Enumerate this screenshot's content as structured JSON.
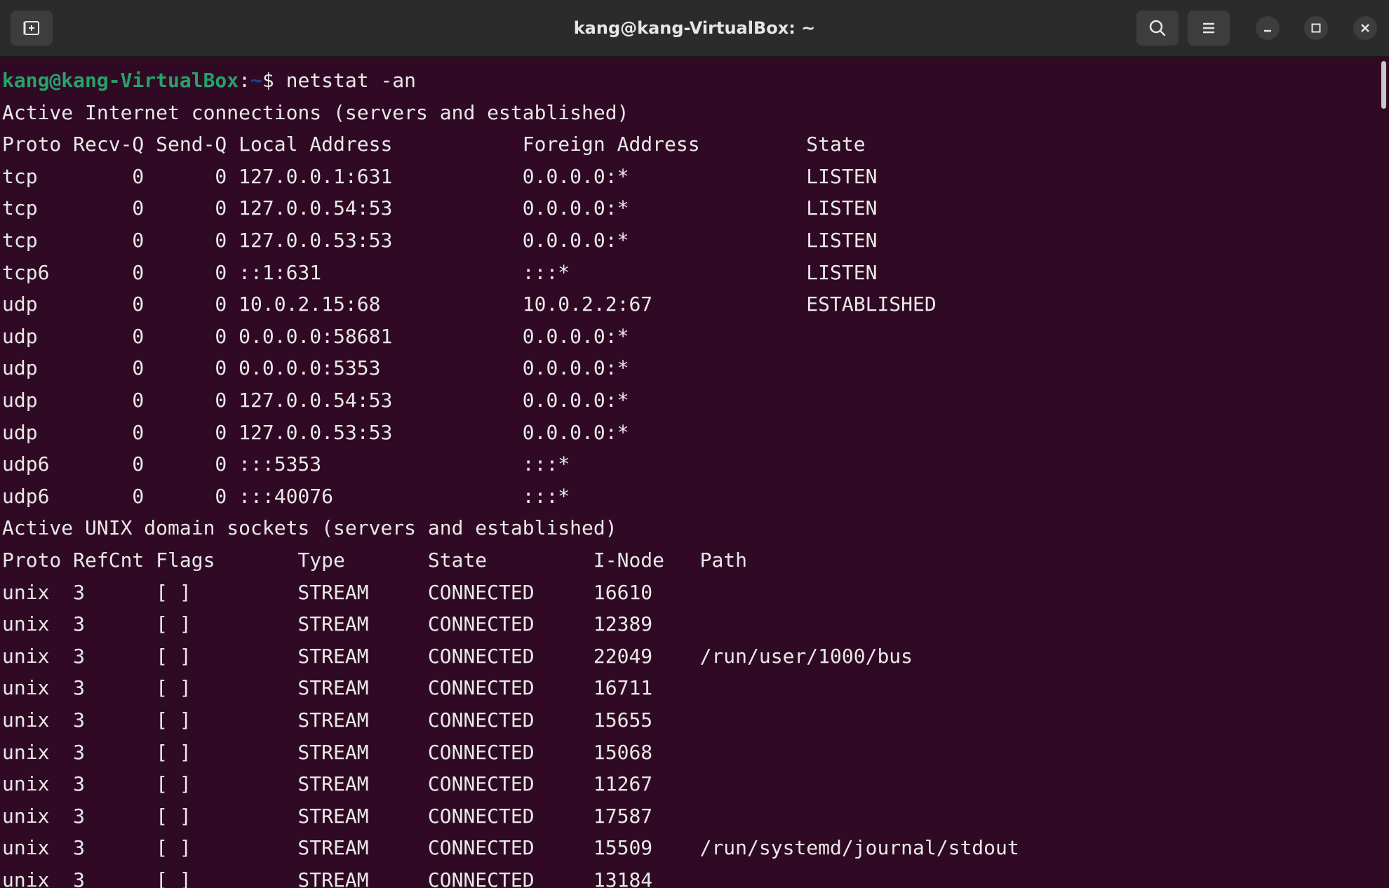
{
  "window": {
    "title": "kang@kang-VirtualBox: ~"
  },
  "icons": {
    "new_tab": "new-tab-icon",
    "search": "search-icon",
    "menu": "hamburger-menu-icon",
    "minimize": "minimize-icon",
    "maximize": "maximize-icon",
    "close": "close-icon"
  },
  "colors": {
    "background": "#300a24",
    "titlebar": "#2b2b2b",
    "prompt_user": "#26a269",
    "prompt_path": "#12488b",
    "text": "#e8e8e8"
  },
  "terminal": {
    "prompt": {
      "user_host": "kang@kang-VirtualBox",
      "colon": ":",
      "path": "~",
      "symbol": "$ ",
      "command": "netstat -an"
    },
    "lines": [
      "Active Internet connections (servers and established)",
      "Proto Recv-Q Send-Q Local Address           Foreign Address         State      ",
      "tcp        0      0 127.0.0.1:631           0.0.0.0:*               LISTEN     ",
      "tcp        0      0 127.0.0.54:53           0.0.0.0:*               LISTEN     ",
      "tcp        0      0 127.0.0.53:53           0.0.0.0:*               LISTEN     ",
      "tcp6       0      0 ::1:631                 :::*                    LISTEN     ",
      "udp        0      0 10.0.2.15:68            10.0.2.2:67             ESTABLISHED",
      "udp        0      0 0.0.0.0:58681           0.0.0.0:*                          ",
      "udp        0      0 0.0.0.0:5353            0.0.0.0:*                          ",
      "udp        0      0 127.0.0.54:53           0.0.0.0:*                          ",
      "udp        0      0 127.0.0.53:53           0.0.0.0:*                          ",
      "udp6       0      0 :::5353                 :::*                               ",
      "udp6       0      0 :::40076                :::*                               ",
      "Active UNIX domain sockets (servers and established)",
      "Proto RefCnt Flags       Type       State         I-Node   Path",
      "unix  3      [ ]         STREAM     CONNECTED     16610    ",
      "unix  3      [ ]         STREAM     CONNECTED     12389    ",
      "unix  3      [ ]         STREAM     CONNECTED     22049    /run/user/1000/bus",
      "unix  3      [ ]         STREAM     CONNECTED     16711    ",
      "unix  3      [ ]         STREAM     CONNECTED     15655    ",
      "unix  3      [ ]         STREAM     CONNECTED     15068    ",
      "unix  3      [ ]         STREAM     CONNECTED     11267    ",
      "unix  3      [ ]         STREAM     CONNECTED     17587    ",
      "unix  3      [ ]         STREAM     CONNECTED     15509    /run/systemd/journal/stdout",
      "unix  3      [ ]         STREAM     CONNECTED     13184    "
    ]
  }
}
